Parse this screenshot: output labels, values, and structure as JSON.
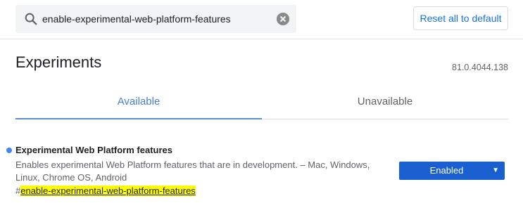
{
  "search": {
    "query": "enable-experimental-web-platform-features",
    "search_icon": "search-icon",
    "clear_icon": "clear-icon"
  },
  "toolbar": {
    "reset_label": "Reset all to default"
  },
  "header": {
    "title": "Experiments",
    "version": "81.0.4044.138"
  },
  "tabs": [
    {
      "label": "Available",
      "selected": true
    },
    {
      "label": "Unavailable",
      "selected": false
    }
  ],
  "feature": {
    "name": "Experimental Web Platform features",
    "description": "Enables experimental Web Platform features that are in development. – Mac, Windows, Linux, Chrome OS, Android",
    "link_hash": "#",
    "link_text": "enable-experimental-web-platform-features",
    "select_value": "Enabled",
    "dropdown_icon": "chevron-down-icon"
  },
  "colors": {
    "accent": "#1a73e8",
    "select_bg": "#1a5fd0",
    "dot": "#4285f4",
    "highlight": "#ffff00"
  }
}
